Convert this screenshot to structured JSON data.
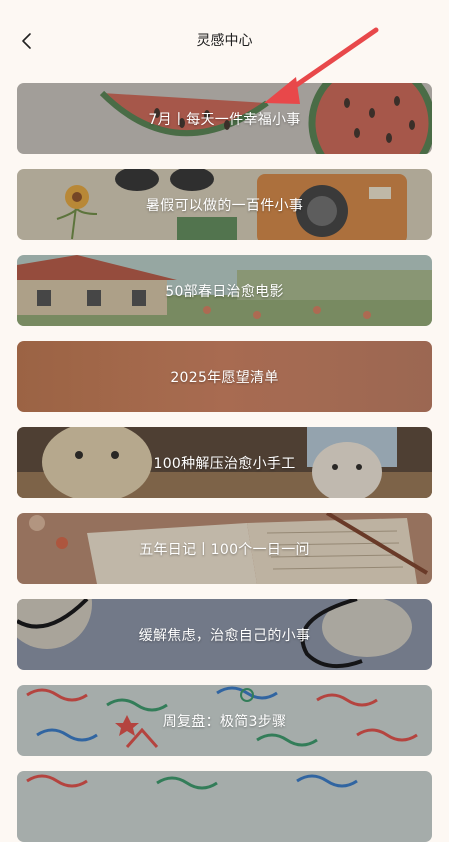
{
  "header": {
    "title": "灵感中心",
    "back_icon": "chevron-left-icon"
  },
  "annotation": {
    "arrow_color": "#e8484a"
  },
  "cards": [
    {
      "label": "7月丨每天一件幸福小事"
    },
    {
      "label": "暑假可以做的一百件小事"
    },
    {
      "label": "50部春日治愈电影"
    },
    {
      "label": "2025年愿望清单"
    },
    {
      "label": "100种解压治愈小手工"
    },
    {
      "label": "五年日记丨100个一日一问"
    },
    {
      "label": "缓解焦虑，治愈自己的小事"
    },
    {
      "label": "周复盘：极简3步骤"
    },
    {
      "label": ""
    }
  ]
}
